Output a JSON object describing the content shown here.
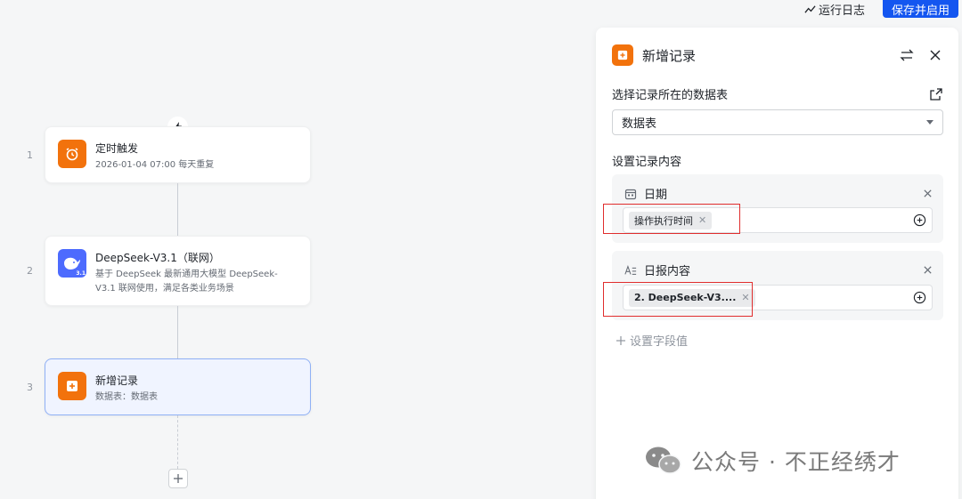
{
  "top": {
    "log_label": "运行日志",
    "save_label": "保存并启用"
  },
  "flow": {
    "nodes": [
      {
        "num": "1",
        "title": "定时触发",
        "desc": "2026-01-04 07:00 每天重复",
        "icon": "alarm-clock-icon"
      },
      {
        "num": "2",
        "title": "DeepSeek-V3.1（联网）",
        "desc": "基于 DeepSeek 最新通用大模型 DeepSeek-V3.1 联网使用，满足各类业务场景",
        "icon": "deepseek-whale-icon",
        "badge": "3.1"
      },
      {
        "num": "3",
        "title": "新增记录",
        "desc": "数据表：数据表",
        "icon": "add-record-icon"
      }
    ]
  },
  "panel": {
    "title": "新增记录",
    "table_label": "选择记录所在的数据表",
    "table_value": "数据表",
    "content_label": "设置记录内容",
    "fields": [
      {
        "name": "日期",
        "icon": "calendar-icon",
        "tag": "操作执行时间"
      },
      {
        "name": "日报内容",
        "icon": "text-field-icon",
        "tag": "2. DeepSeek-V3...."
      }
    ],
    "add_field_label": "设置字段值"
  },
  "watermark": {
    "text": "公众号 · 不正经绣才"
  },
  "colors": {
    "accent": "#1456f0",
    "node_orange": "#f2720c",
    "deepseek_blue": "#4d6bfe",
    "highlight_red": "#e02d2d"
  }
}
